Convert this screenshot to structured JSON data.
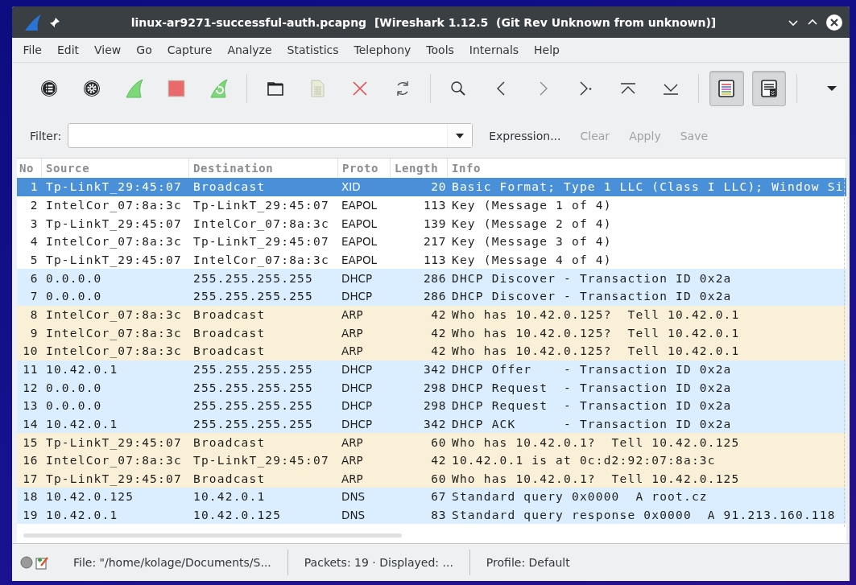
{
  "window": {
    "title": "linux-ar9271-successful-auth.pcapng  [Wireshark 1.12.5  (Git Rev Unknown from unknown)]"
  },
  "menu": [
    "File",
    "Edit",
    "View",
    "Go",
    "Capture",
    "Analyze",
    "Statistics",
    "Telephony",
    "Tools",
    "Internals",
    "Help"
  ],
  "toolbar": [
    {
      "kind": "interfaces"
    },
    {
      "kind": "options"
    },
    {
      "kind": "start"
    },
    {
      "kind": "stop"
    },
    {
      "kind": "restart"
    },
    {
      "kind": "separator"
    },
    {
      "kind": "open"
    },
    {
      "kind": "save"
    },
    {
      "kind": "close"
    },
    {
      "kind": "reload"
    },
    {
      "kind": "separator"
    },
    {
      "kind": "find"
    },
    {
      "kind": "back"
    },
    {
      "kind": "forward"
    },
    {
      "kind": "goto"
    },
    {
      "kind": "first"
    },
    {
      "kind": "last"
    },
    {
      "kind": "separator"
    },
    {
      "kind": "colorize",
      "pressed": true
    },
    {
      "kind": "autoscroll",
      "pressed": true
    },
    {
      "kind": "separator"
    },
    {
      "kind": "more"
    }
  ],
  "filter": {
    "label": "Filter:",
    "buttons": [
      {
        "label": "Expression...",
        "disabled": false
      },
      {
        "label": "Clear",
        "disabled": true
      },
      {
        "label": "Apply",
        "disabled": true
      },
      {
        "label": "Save",
        "disabled": true
      }
    ]
  },
  "table": {
    "columns": [
      "No",
      "Source",
      "Destination",
      "Proto",
      "Length",
      "Info"
    ],
    "rows": [
      {
        "no": "1",
        "source": "Tp-LinkT_29:45:07",
        "destination": "Broadcast",
        "protocol": "XID",
        "length": "20",
        "info": "Basic Format; Type 1 LLC (Class I LLC); Window Si",
        "selected": true
      },
      {
        "no": "2",
        "source": "IntelCor_07:8a:3c",
        "destination": "Tp-LinkT_29:45:07",
        "protocol": "EAPOL",
        "length": "113",
        "info": "Key (Message 1 of 4)",
        "color": "#ffffff",
        "selected": false
      },
      {
        "no": "3",
        "source": "Tp-LinkT_29:45:07",
        "destination": "IntelCor_07:8a:3c",
        "protocol": "EAPOL",
        "length": "139",
        "info": "Key (Message 2 of 4)",
        "color": "#ffffff",
        "selected": false
      },
      {
        "no": "4",
        "source": "IntelCor_07:8a:3c",
        "destination": "Tp-LinkT_29:45:07",
        "protocol": "EAPOL",
        "length": "217",
        "info": "Key (Message 3 of 4)",
        "color": "#ffffff",
        "selected": false
      },
      {
        "no": "5",
        "source": "Tp-LinkT_29:45:07",
        "destination": "IntelCor_07:8a:3c",
        "protocol": "EAPOL",
        "length": "113",
        "info": "Key (Message 4 of 4)",
        "color": "#ffffff",
        "selected": false
      },
      {
        "no": "6",
        "source": "0.0.0.0",
        "destination": "255.255.255.255",
        "protocol": "DHCP",
        "length": "286",
        "info": "DHCP Discover - Transaction ID 0x2a",
        "color": "#daeeff",
        "selected": false
      },
      {
        "no": "7",
        "source": "0.0.0.0",
        "destination": "255.255.255.255",
        "protocol": "DHCP",
        "length": "286",
        "info": "DHCP Discover - Transaction ID 0x2a",
        "color": "#daeeff",
        "selected": false
      },
      {
        "no": "8",
        "source": "IntelCor_07:8a:3c",
        "destination": "Broadcast",
        "protocol": "ARP",
        "length": "42",
        "info": "Who has 10.42.0.125?  Tell 10.42.0.1",
        "color": "#faf0d7",
        "selected": false
      },
      {
        "no": "9",
        "source": "IntelCor_07:8a:3c",
        "destination": "Broadcast",
        "protocol": "ARP",
        "length": "42",
        "info": "Who has 10.42.0.125?  Tell 10.42.0.1",
        "color": "#faf0d7",
        "selected": false
      },
      {
        "no": "10",
        "source": "IntelCor_07:8a:3c",
        "destination": "Broadcast",
        "protocol": "ARP",
        "length": "42",
        "info": "Who has 10.42.0.125?  Tell 10.42.0.1",
        "color": "#faf0d7",
        "selected": false
      },
      {
        "no": "11",
        "source": "10.42.0.1",
        "destination": "255.255.255.255",
        "protocol": "DHCP",
        "length": "342",
        "info": "DHCP Offer    - Transaction ID 0x2a",
        "color": "#daeeff",
        "selected": false
      },
      {
        "no": "12",
        "source": "0.0.0.0",
        "destination": "255.255.255.255",
        "protocol": "DHCP",
        "length": "298",
        "info": "DHCP Request  - Transaction ID 0x2a",
        "color": "#daeeff",
        "selected": false
      },
      {
        "no": "13",
        "source": "0.0.0.0",
        "destination": "255.255.255.255",
        "protocol": "DHCP",
        "length": "298",
        "info": "DHCP Request  - Transaction ID 0x2a",
        "color": "#daeeff",
        "selected": false
      },
      {
        "no": "14",
        "source": "10.42.0.1",
        "destination": "255.255.255.255",
        "protocol": "DHCP",
        "length": "342",
        "info": "DHCP ACK      - Transaction ID 0x2a",
        "color": "#daeeff",
        "selected": false
      },
      {
        "no": "15",
        "source": "Tp-LinkT_29:45:07",
        "destination": "Broadcast",
        "protocol": "ARP",
        "length": "60",
        "info": "Who has 10.42.0.1?  Tell 10.42.0.125",
        "color": "#faf0d7",
        "selected": false
      },
      {
        "no": "16",
        "source": "IntelCor_07:8a:3c",
        "destination": "Tp-LinkT_29:45:07",
        "protocol": "ARP",
        "length": "42",
        "info": "10.42.0.1 is at 0c:d2:92:07:8a:3c",
        "color": "#faf0d7",
        "selected": false
      },
      {
        "no": "17",
        "source": "Tp-LinkT_29:45:07",
        "destination": "Broadcast",
        "protocol": "ARP",
        "length": "60",
        "info": "Who has 10.42.0.1?  Tell 10.42.0.125",
        "color": "#faf0d7",
        "selected": false
      },
      {
        "no": "18",
        "source": "10.42.0.125",
        "destination": "10.42.0.1",
        "protocol": "DNS",
        "length": "67",
        "info": "Standard query 0x0000  A root.cz",
        "color": "#daeeff",
        "selected": false
      },
      {
        "no": "19",
        "source": "10.42.0.1",
        "destination": "10.42.0.125",
        "protocol": "DNS",
        "length": "83",
        "info": "Standard query response 0x0000  A 91.213.160.118",
        "color": "#daeeff",
        "selected": false
      }
    ]
  },
  "status_bar": {
    "file": "File: \"/home/kolage/Documents/S...",
    "packets": "Packets: 19 · Displayed: ...",
    "profile": "Profile: Default"
  }
}
